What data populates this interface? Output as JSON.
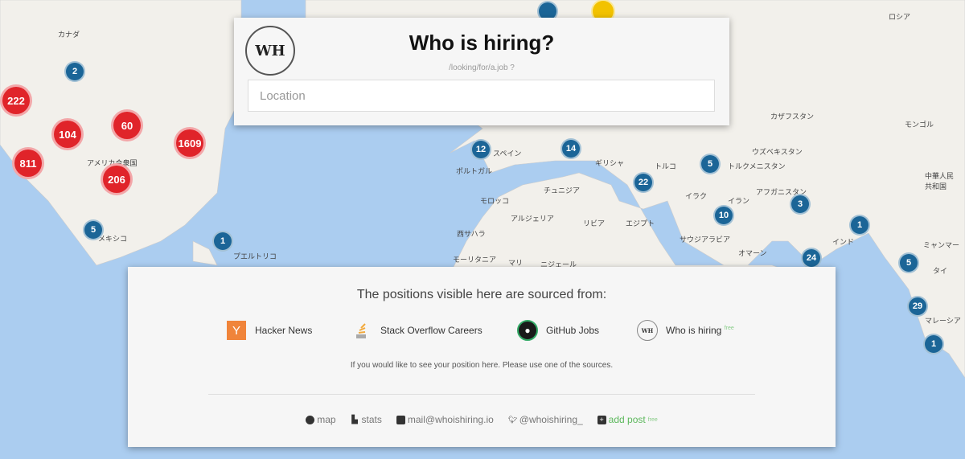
{
  "header": {
    "logo_text": "WH",
    "title": "Who is hiring?",
    "subtitle": "/looking/for/a.job ?",
    "location_placeholder": "Location"
  },
  "footer": {
    "sources_title": "The positions visible here are sourced from:",
    "sources": [
      {
        "label": "Hacker News",
        "icon": "hacker-news-icon"
      },
      {
        "label": "Stack Overflow Careers",
        "icon": "stack-overflow-icon"
      },
      {
        "label": "GitHub Jobs",
        "icon": "github-icon"
      },
      {
        "label": "Who is hiring",
        "badge": "free",
        "icon": "whoishiring-icon",
        "icon_text": "WH"
      }
    ],
    "note": "If you would like to see your position here. Please use one of the sources.",
    "links": [
      {
        "label": "map",
        "icon": "globe-icon"
      },
      {
        "label": "stats",
        "icon": "bar-chart-icon"
      },
      {
        "label": "mail@whoishiring.io",
        "icon": "mail-icon"
      },
      {
        "label": "@whoishiring_",
        "icon": "twitter-icon"
      },
      {
        "label": "add post",
        "badge": "free",
        "icon": "plus-icon",
        "color": "#5cb85c"
      }
    ]
  },
  "map": {
    "labels": [
      "カナダ",
      "アメリカ合衆国",
      "メキシコ",
      "プエルトリコ",
      "ロシア",
      "カザフスタン",
      "モンゴル",
      "ウズベキスタン",
      "トルクメニスタン",
      "アフガニスタン",
      "イラン",
      "イラク",
      "トルコ",
      "ギリシャ",
      "スペイン",
      "ポルトガル",
      "モロッコ",
      "アルジェリア",
      "リビア",
      "エジプト",
      "サウジアラビア",
      "モーリタニア",
      "マリ",
      "ニジェール",
      "インド",
      "タイ",
      "マレーシア",
      "中華人民共和国",
      "チュニジア",
      "西サハラ",
      "オマーン",
      "ミャンマー"
    ],
    "clusters": [
      {
        "count": "222",
        "type": "red"
      },
      {
        "count": "104",
        "type": "red"
      },
      {
        "count": "60",
        "type": "red"
      },
      {
        "count": "1609",
        "type": "red"
      },
      {
        "count": "811",
        "type": "red"
      },
      {
        "count": "206",
        "type": "red"
      },
      {
        "count": "2",
        "type": "blue"
      },
      {
        "count": "5",
        "type": "blue"
      },
      {
        "count": "1",
        "type": "blue"
      },
      {
        "count": "12",
        "type": "blue"
      },
      {
        "count": "14",
        "type": "blue"
      },
      {
        "count": "5",
        "type": "blue"
      },
      {
        "count": "22",
        "type": "blue"
      },
      {
        "count": "3",
        "type": "blue"
      },
      {
        "count": "10",
        "type": "blue"
      },
      {
        "count": "1",
        "type": "blue"
      },
      {
        "count": "24",
        "type": "blue"
      },
      {
        "count": "5",
        "type": "blue"
      },
      {
        "count": "29",
        "type": "blue"
      },
      {
        "count": "1",
        "type": "blue"
      }
    ]
  }
}
